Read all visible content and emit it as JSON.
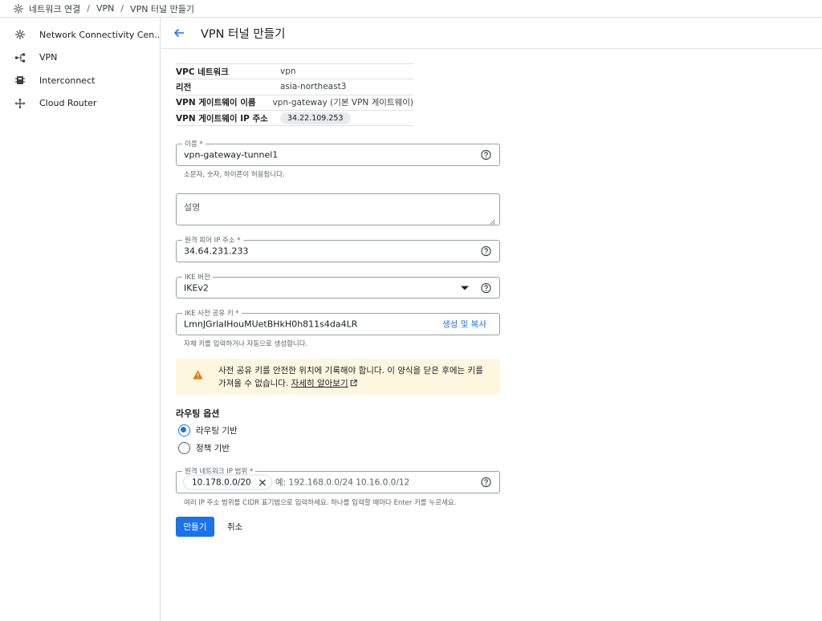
{
  "breadcrumb": {
    "items": [
      "네트워크 연결",
      "VPN",
      "VPN 터널 만들기"
    ],
    "separator": "/"
  },
  "sidebar": {
    "items": [
      {
        "label": "Network Connectivity Cen...",
        "icon": "hub-icon"
      },
      {
        "label": "VPN",
        "icon": "vpn-icon"
      },
      {
        "label": "Interconnect",
        "icon": "interconnect-icon"
      },
      {
        "label": "Cloud Router",
        "icon": "router-icon"
      }
    ]
  },
  "header": {
    "title": "VPN 터널 만들기"
  },
  "info": {
    "rows": [
      {
        "key": "VPC 네트워크",
        "value": "vpn"
      },
      {
        "key": "리전",
        "value": "asia-northeast3"
      },
      {
        "key": "VPN 게이트웨이 이름",
        "value": "vpn-gateway (기본 VPN 게이트웨이)"
      },
      {
        "key": "VPN 게이트웨이 IP 주소",
        "value": "34.22.109.253"
      }
    ]
  },
  "form": {
    "name": {
      "label": "이름 *",
      "value": "vpn-gateway-tunnel1",
      "hint": "소문자, 숫자, 하이픈이 허용됩니다."
    },
    "description": {
      "placeholder": "설명"
    },
    "peer_ip": {
      "label": "원격 피어 IP 주소 *",
      "value": "34.64.231.233"
    },
    "ike_version": {
      "label": "IKE 버전",
      "value": "IKEv2"
    },
    "shared_key": {
      "label": "IKE 사전 공유 키 *",
      "value": "LmnJGrlaIHouMUetBHkH0h811s4da4LR",
      "action": "생성 및 복사",
      "hint": "자체 키를 입력하거나 자동으로 생성합니다."
    },
    "warning": {
      "text": "사전 공유 키를 안전한 위치에 기록해야 합니다. 이 양식을 닫은 후에는 키를 가져올 수 없습니다.",
      "link": "자세히 알아보기"
    },
    "routing": {
      "title": "라우팅 옵션",
      "options": [
        {
          "label": "라우팅 기반",
          "selected": true
        },
        {
          "label": "정책 기반",
          "selected": false
        }
      ]
    },
    "remote_ranges": {
      "label": "원격 네트워크 IP 범위 *",
      "chip": "10.178.0.0/20",
      "placeholder": "예: 192.168.0.0/24 10.16.0.0/12",
      "hint": "여러 IP 주소 범위를 CIDR 표기법으로 입력하세요. 하나를 입력할 때마다 Enter 키를 누르세요."
    }
  },
  "actions": {
    "create": "만들기",
    "cancel": "취소"
  },
  "colors": {
    "accent": "#1a73e8",
    "warning_bg": "#fef7e0",
    "warning_icon": "#e37400"
  }
}
